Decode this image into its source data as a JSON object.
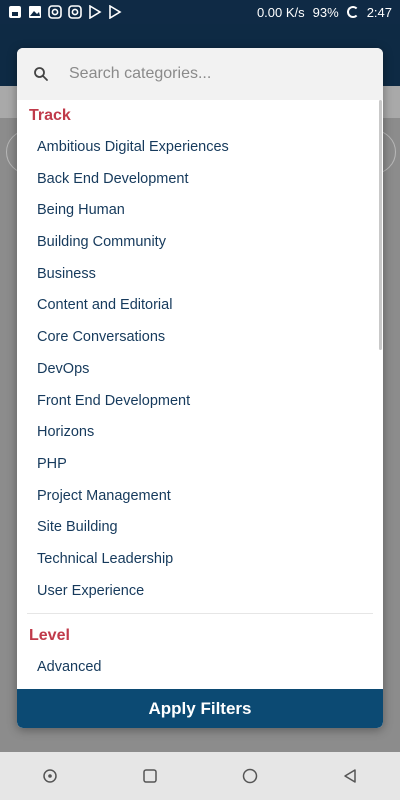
{
  "status_bar": {
    "network_speed": "0.00 K/s",
    "battery": "93%",
    "time": "2:47"
  },
  "modal": {
    "search_placeholder": "Search categories...",
    "sections": [
      {
        "title": "Track",
        "items": [
          "Ambitious Digital Experiences",
          "Back End Development",
          "Being Human",
          "Building Community",
          "Business",
          "Content and Editorial",
          "Core Conversations",
          "DevOps",
          "Front End Development",
          "Horizons",
          "PHP",
          "Project Management",
          "Site Building",
          "Technical Leadership",
          "User Experience"
        ]
      },
      {
        "title": "Level",
        "items": [
          "Advanced"
        ]
      }
    ],
    "apply_label": "Apply Filters"
  },
  "colors": {
    "section_title": "#c03a4a",
    "item_text": "#163a5c",
    "apply_button": "#0c4a73",
    "status_bar": "#0f2a45"
  }
}
